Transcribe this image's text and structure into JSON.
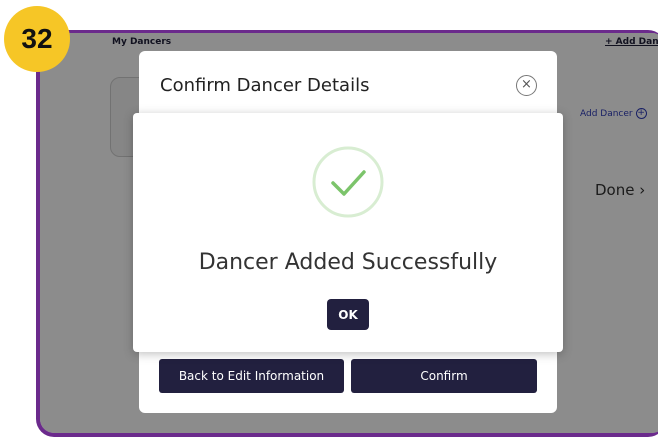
{
  "step_badge": "32",
  "page": {
    "title": "My Dancers",
    "add_link": "+ Add Danc",
    "add_dancer_label": "Add Dancer",
    "done_label": "Done",
    "done_chevron": "›"
  },
  "confirm_dialog": {
    "title": "Confirm Dancer Details",
    "close_symbol": "×",
    "back_button": "Back to Edit Information",
    "confirm_button": "Confirm"
  },
  "success_modal": {
    "icon": "check-icon",
    "message": "Dancer Added Successfully",
    "ok_button": "OK"
  },
  "colors": {
    "frame": "#6b2a8c",
    "badge": "#f6c626",
    "primary_button": "#22203f",
    "check_green": "#7cc46b"
  }
}
